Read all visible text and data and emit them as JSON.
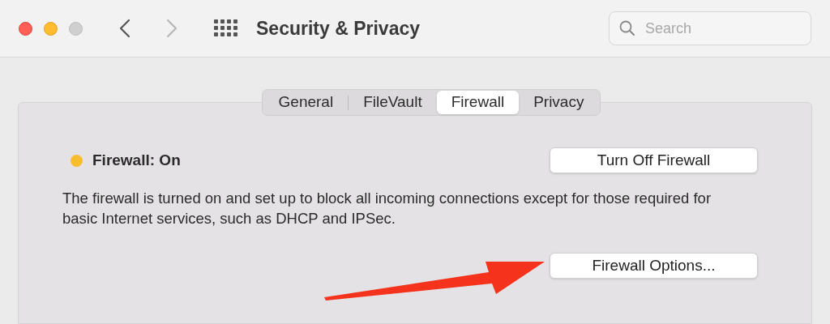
{
  "window": {
    "title": "Security & Privacy"
  },
  "navigation": {
    "back_disabled": false,
    "forward_disabled": true
  },
  "search": {
    "placeholder": "Search"
  },
  "tabs": [
    {
      "label": "General",
      "selected": false
    },
    {
      "label": "FileVault",
      "selected": false
    },
    {
      "label": "Firewall",
      "selected": true
    },
    {
      "label": "Privacy",
      "selected": false
    }
  ],
  "firewall": {
    "status": "Firewall: On",
    "on": true,
    "description": "The firewall is turned on and set up to block all incoming connections except for those required for basic Internet services, such as DHCP and IPSec.",
    "toggle_button": "Turn Off Firewall",
    "options_button": "Firewall Options..."
  }
}
